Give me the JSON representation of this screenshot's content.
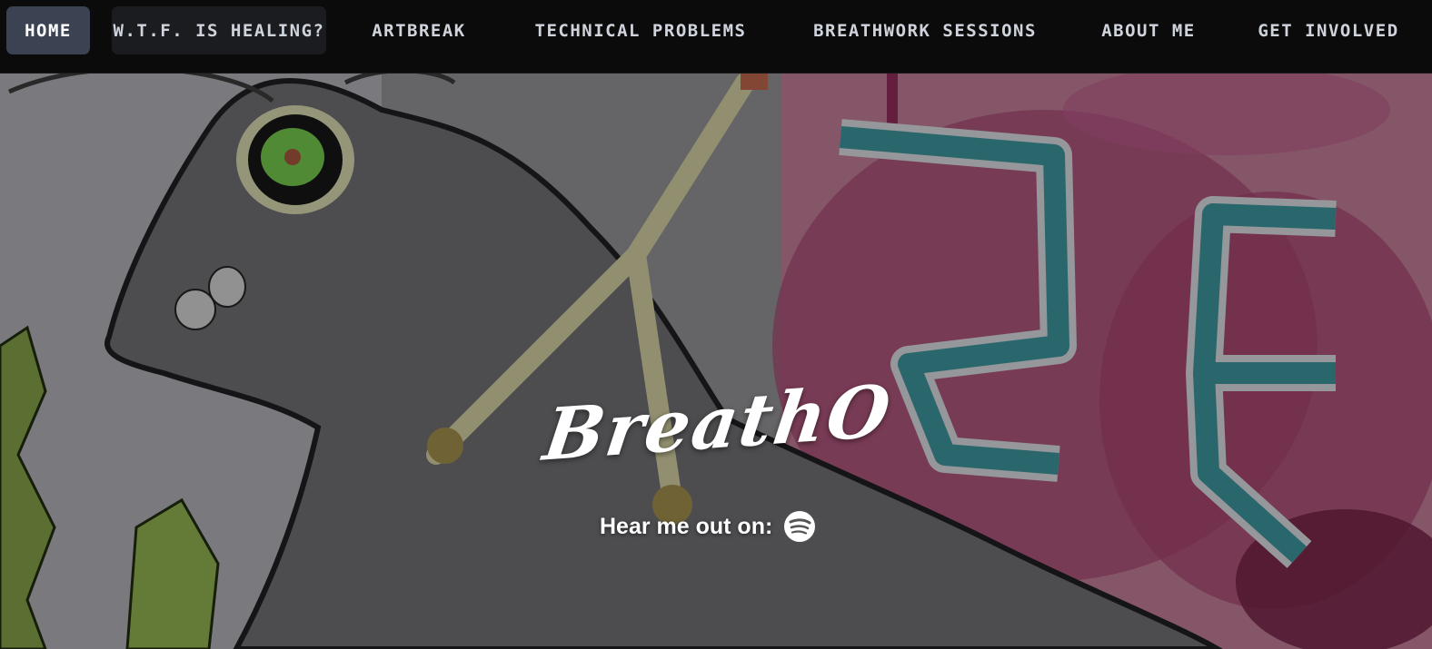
{
  "nav": {
    "items": [
      {
        "label": "HOME",
        "active": true
      },
      {
        "label": "W.T.F. IS HEALING?",
        "active": false
      },
      {
        "label": "ARTBREAK",
        "active": false
      },
      {
        "label": "TECHNICAL PROBLEMS",
        "active": false
      },
      {
        "label": "BREATHWORK SESSIONS",
        "active": false
      },
      {
        "label": "ABOUT ME",
        "active": false
      },
      {
        "label": "GET INVOLVED",
        "active": false
      }
    ]
  },
  "hero": {
    "title": "BreathO",
    "listen_label": "Hear me out on:",
    "listen_icon": "spotify-icon"
  },
  "colors": {
    "nav_bg": "#0b0b0b",
    "nav_active_bg": "#3b4252",
    "nav_text": "#cfd4dc"
  }
}
